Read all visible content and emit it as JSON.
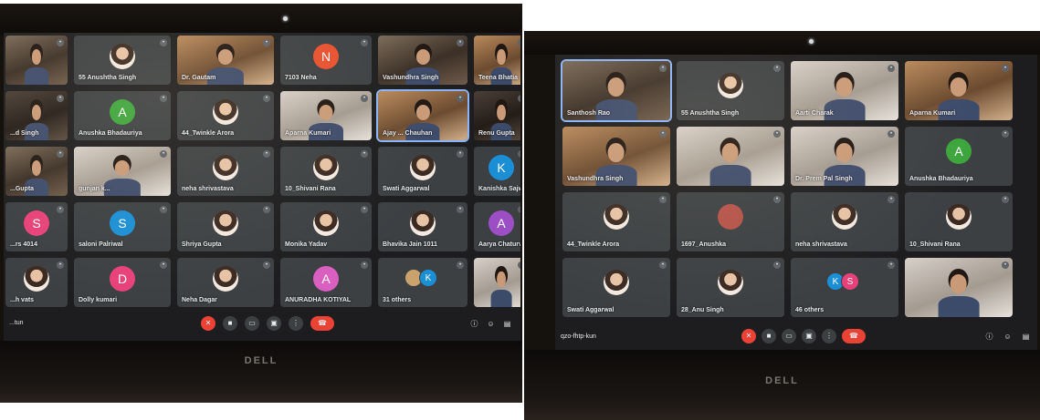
{
  "left_photo": {
    "meeting_code": "...tun",
    "brand": "DELL",
    "tiles": [
      {
        "name": "",
        "kind": "video",
        "tone": "v-room"
      },
      {
        "name": "55 Anushtha Singh",
        "kind": "pic"
      },
      {
        "name": "Dr. Gautam",
        "kind": "video",
        "tone": "v-warm"
      },
      {
        "name": "7103 Neha",
        "kind": "avatar",
        "letter": "N",
        "color": "#e8502e"
      },
      {
        "name": "Vashundhra Singh",
        "kind": "video",
        "tone": "v-room"
      },
      {
        "name": "Teena Bhatia",
        "kind": "video",
        "tone": "v-warm"
      },
      {
        "name": "...d Singh",
        "kind": "video",
        "tone": "v-dark"
      },
      {
        "name": "Anushka Bhadauriya",
        "kind": "avatar",
        "letter": "A",
        "color": "#3ca53c"
      },
      {
        "name": "44_Twinkle Arora",
        "kind": "pic"
      },
      {
        "name": "Aparna Kumari",
        "kind": "video",
        "tone": "v-light"
      },
      {
        "name": "Ajay ... Chauhan",
        "kind": "video",
        "tone": "v-warm",
        "pinned": true
      },
      {
        "name": "Renu Gupta",
        "kind": "video",
        "tone": "v-dark"
      },
      {
        "name": "...Gupta",
        "kind": "video",
        "tone": "v-room"
      },
      {
        "name": "gunjan k...",
        "kind": "video",
        "tone": "v-light"
      },
      {
        "name": "neha shrivastava",
        "kind": "pic"
      },
      {
        "name": "10_Shivani Rana",
        "kind": "pic"
      },
      {
        "name": "Swati Aggarwal",
        "kind": "pic"
      },
      {
        "name": "Kanishka Sajwan",
        "kind": "avatar",
        "letter": "K",
        "color": "#1a8fd6"
      },
      {
        "name": "...rs 4014",
        "kind": "avatar",
        "letter": "S",
        "color": "#e8417a"
      },
      {
        "name": "saloni Palriwal",
        "kind": "avatar",
        "letter": "S",
        "color": "#1a8fd6"
      },
      {
        "name": "Shriya Gupta",
        "kind": "pic"
      },
      {
        "name": "Monika Yadav",
        "kind": "pic"
      },
      {
        "name": "Bhavika Jain 1011",
        "kind": "pic"
      },
      {
        "name": "Aarya Chaturvedi",
        "kind": "avatar",
        "letter": "A",
        "color": "#9c4fc4"
      },
      {
        "name": "...h vats",
        "kind": "pic"
      },
      {
        "name": "Dolly kumari",
        "kind": "avatar",
        "letter": "D",
        "color": "#e8417a"
      },
      {
        "name": "Neha Dagar",
        "kind": "pic"
      },
      {
        "name": "ANURADHA KOTIYAL",
        "kind": "avatar",
        "letter": "A",
        "color": "#d95fc1"
      },
      {
        "name": "31 others",
        "kind": "others",
        "letters": [
          "",
          "K"
        ],
        "colors": [
          "#c9a36b",
          "#1a8fd6"
        ]
      },
      {
        "name": "",
        "kind": "video",
        "tone": "v-light"
      }
    ]
  },
  "right_photo": {
    "meeting_code": "qzo-fhtp-kun",
    "brand": "DELL",
    "tiles": [
      {
        "name": "Santhosh Rao",
        "kind": "video",
        "tone": "v-room",
        "pinned": true
      },
      {
        "name": "55 Anushtha Singh",
        "kind": "pic"
      },
      {
        "name": "Aarti Charak",
        "kind": "video",
        "tone": "v-light"
      },
      {
        "name": "Aparna Kumari",
        "kind": "video",
        "tone": "v-warm"
      },
      {
        "name": "Vashundhra Singh",
        "kind": "video",
        "tone": "v-warm"
      },
      {
        "name": "",
        "kind": "video",
        "tone": "v-light"
      },
      {
        "name": "Dr. Prem Pal Singh",
        "kind": "video",
        "tone": "v-light"
      },
      {
        "name": "Anushka Bhadauriya",
        "kind": "avatar",
        "letter": "A",
        "color": "#3ca53c"
      },
      {
        "name": "44_Twinkle Arora",
        "kind": "pic"
      },
      {
        "name": "1697_Anushka",
        "kind": "avatar",
        "letter": "",
        "color": "#b5524a"
      },
      {
        "name": "neha shrivastava",
        "kind": "pic"
      },
      {
        "name": "10_Shivani Rana",
        "kind": "pic"
      },
      {
        "name": "Swati Aggarwal",
        "kind": "pic"
      },
      {
        "name": "28_Anu Singh",
        "kind": "pic"
      },
      {
        "name": "46 others",
        "kind": "others",
        "letters": [
          "K",
          "S"
        ],
        "colors": [
          "#1a8fd6",
          "#e8417a"
        ]
      },
      {
        "name": "",
        "kind": "video",
        "tone": "v-light"
      }
    ]
  }
}
